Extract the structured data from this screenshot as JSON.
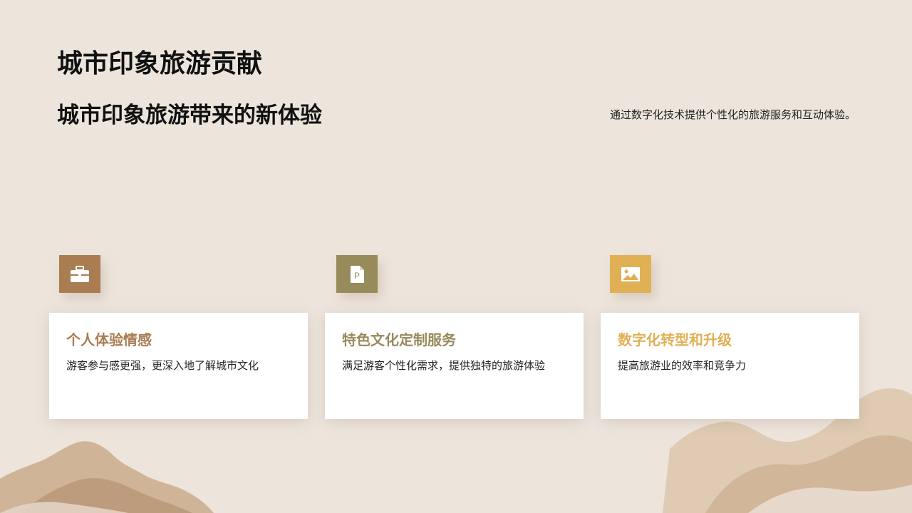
{
  "slide": {
    "title": "城市印象旅游贡献",
    "subtitle": "城市印象旅游带来的新体验",
    "description": "通过数字化技术提供个性化的旅游服务和互动体验。"
  },
  "cards": [
    {
      "title": "个人体验情感",
      "text": "游客参与感更强，更深入地了解城市文化",
      "icon": "briefcase-icon",
      "color": "#a97c52"
    },
    {
      "title": "特色文化定制服务",
      "text": "满足游客个性化需求，提供独特的旅游体验",
      "icon": "document-p-icon",
      "color": "#978a5b"
    },
    {
      "title": "数字化转型和升级",
      "text": "提高旅游业的效率和竞争力",
      "icon": "image-icon",
      "color": "#e0b055"
    }
  ]
}
